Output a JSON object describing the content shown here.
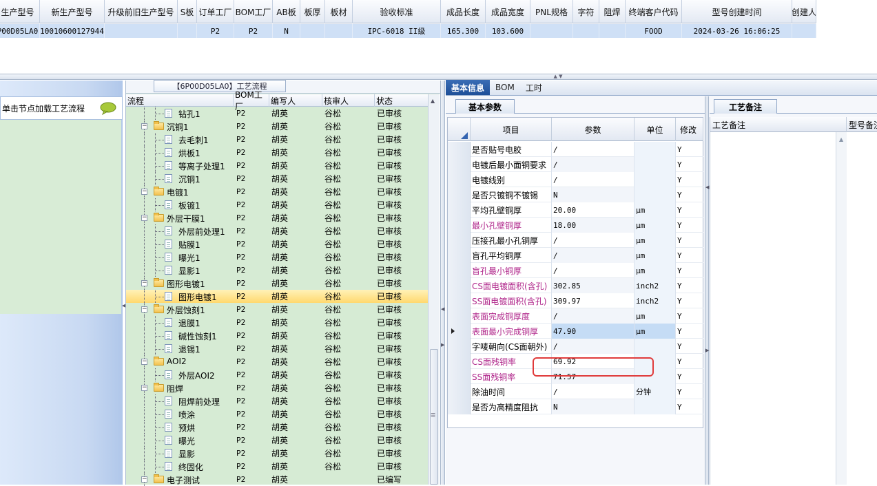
{
  "top_grid": {
    "columns": [
      "生产型号",
      "新生产型号",
      "升级前旧生产型号",
      "S板",
      "订单工厂",
      "BOM工厂",
      "AB板",
      "板厚",
      "板材",
      "验收标准",
      "成品长度",
      "成品宽度",
      "PNL规格",
      "字符",
      "阻焊",
      "终端客户代码",
      "型号创建时间",
      "创建人"
    ],
    "row": [
      "P00D05LA0",
      "10010600127944",
      "",
      "",
      "P2",
      "P2",
      "N",
      "",
      "",
      "IPC-6018 II级",
      "165.300",
      "103.600",
      "",
      "",
      "",
      "FOOD",
      "2024-03-26 16:06:25",
      ""
    ]
  },
  "left_panel": {
    "hint": "单击节点加载工艺流程",
    "icon": "speech-bubble-icon"
  },
  "tree_panel": {
    "title": "【6P00D05LA0】工艺流程",
    "columns": [
      "流程",
      "BOM工厂",
      "编写人",
      "核审人",
      "状态"
    ],
    "rows": [
      {
        "name": "钻孔1",
        "bom": "P2",
        "author": "胡英",
        "reviewer": "谷松",
        "status": "已审核",
        "level": 1,
        "folder": false
      },
      {
        "name": "沉铜1",
        "bom": "P2",
        "author": "胡英",
        "reviewer": "谷松",
        "status": "已审核",
        "level": 0,
        "folder": true
      },
      {
        "name": "去毛刺1",
        "bom": "P2",
        "author": "胡英",
        "reviewer": "谷松",
        "status": "已审核",
        "level": 1,
        "folder": false
      },
      {
        "name": "烘板1",
        "bom": "P2",
        "author": "胡英",
        "reviewer": "谷松",
        "status": "已审核",
        "level": 1,
        "folder": false
      },
      {
        "name": "等离子处理1",
        "bom": "P2",
        "author": "胡英",
        "reviewer": "谷松",
        "status": "已审核",
        "level": 1,
        "folder": false
      },
      {
        "name": "沉铜1",
        "bom": "P2",
        "author": "胡英",
        "reviewer": "谷松",
        "status": "已审核",
        "level": 1,
        "folder": false
      },
      {
        "name": "电镀1",
        "bom": "P2",
        "author": "胡英",
        "reviewer": "谷松",
        "status": "已审核",
        "level": 0,
        "folder": true
      },
      {
        "name": "板镀1",
        "bom": "P2",
        "author": "胡英",
        "reviewer": "谷松",
        "status": "已审核",
        "level": 1,
        "folder": false
      },
      {
        "name": "外层干膜1",
        "bom": "P2",
        "author": "胡英",
        "reviewer": "谷松",
        "status": "已审核",
        "level": 0,
        "folder": true
      },
      {
        "name": "外层前处理1",
        "bom": "P2",
        "author": "胡英",
        "reviewer": "谷松",
        "status": "已审核",
        "level": 1,
        "folder": false
      },
      {
        "name": "贴膜1",
        "bom": "P2",
        "author": "胡英",
        "reviewer": "谷松",
        "status": "已审核",
        "level": 1,
        "folder": false
      },
      {
        "name": "曝光1",
        "bom": "P2",
        "author": "胡英",
        "reviewer": "谷松",
        "status": "已审核",
        "level": 1,
        "folder": false
      },
      {
        "name": "显影1",
        "bom": "P2",
        "author": "胡英",
        "reviewer": "谷松",
        "status": "已审核",
        "level": 1,
        "folder": false
      },
      {
        "name": "图形电镀1",
        "bom": "P2",
        "author": "胡英",
        "reviewer": "谷松",
        "status": "已审核",
        "level": 0,
        "folder": true
      },
      {
        "name": "图形电镀1",
        "bom": "P2",
        "author": "胡英",
        "reviewer": "谷松",
        "status": "已审核",
        "level": 1,
        "folder": false,
        "selected": true
      },
      {
        "name": "外层蚀刻1",
        "bom": "P2",
        "author": "胡英",
        "reviewer": "谷松",
        "status": "已审核",
        "level": 0,
        "folder": true
      },
      {
        "name": "退膜1",
        "bom": "P2",
        "author": "胡英",
        "reviewer": "谷松",
        "status": "已审核",
        "level": 1,
        "folder": false
      },
      {
        "name": "碱性蚀刻1",
        "bom": "P2",
        "author": "胡英",
        "reviewer": "谷松",
        "status": "已审核",
        "level": 1,
        "folder": false
      },
      {
        "name": "退锡1",
        "bom": "P2",
        "author": "胡英",
        "reviewer": "谷松",
        "status": "已审核",
        "level": 1,
        "folder": false
      },
      {
        "name": "AOI2",
        "bom": "P2",
        "author": "胡英",
        "reviewer": "谷松",
        "status": "已审核",
        "level": 0,
        "folder": true
      },
      {
        "name": "外层AOI2",
        "bom": "P2",
        "author": "胡英",
        "reviewer": "谷松",
        "status": "已审核",
        "level": 1,
        "folder": false
      },
      {
        "name": "阻焊",
        "bom": "P2",
        "author": "胡英",
        "reviewer": "谷松",
        "status": "已审核",
        "level": 0,
        "folder": true
      },
      {
        "name": "阻焊前处理",
        "bom": "P2",
        "author": "胡英",
        "reviewer": "谷松",
        "status": "已审核",
        "level": 1,
        "folder": false
      },
      {
        "name": "喷涂",
        "bom": "P2",
        "author": "胡英",
        "reviewer": "谷松",
        "status": "已审核",
        "level": 1,
        "folder": false
      },
      {
        "name": "预烘",
        "bom": "P2",
        "author": "胡英",
        "reviewer": "谷松",
        "status": "已审核",
        "level": 1,
        "folder": false
      },
      {
        "name": "曝光",
        "bom": "P2",
        "author": "胡英",
        "reviewer": "谷松",
        "status": "已审核",
        "level": 1,
        "folder": false
      },
      {
        "name": "显影",
        "bom": "P2",
        "author": "胡英",
        "reviewer": "谷松",
        "status": "已审核",
        "level": 1,
        "folder": false
      },
      {
        "name": "终固化",
        "bom": "P2",
        "author": "胡英",
        "reviewer": "谷松",
        "status": "已审核",
        "level": 1,
        "folder": false
      },
      {
        "name": "电子测试",
        "bom": "P2",
        "author": "胡英",
        "reviewer": "",
        "status": "已编写",
        "level": 0,
        "folder": true
      }
    ]
  },
  "right_tabs": [
    "基本信息",
    "BOM",
    "工时"
  ],
  "basic_panel": {
    "subtab": "基本参数",
    "columns": [
      "项目",
      "参数",
      "单位",
      "修改"
    ],
    "rows": [
      {
        "item": "是否贴号电胶",
        "param": "/",
        "unit": "",
        "mod": "Y",
        "red": false
      },
      {
        "item": "电镀后最小面铜要求",
        "param": "/",
        "unit": "",
        "mod": "Y",
        "red": false
      },
      {
        "item": "电镀线别",
        "param": "/",
        "unit": "",
        "mod": "Y",
        "red": false
      },
      {
        "item": "是否只镀铜不镀锡",
        "param": "N",
        "unit": "",
        "mod": "Y",
        "red": false
      },
      {
        "item": "平均孔壁铜厚",
        "param": "20.00",
        "unit": "μm",
        "mod": "Y",
        "red": false
      },
      {
        "item": "最小孔壁铜厚",
        "param": "18.00",
        "unit": "μm",
        "mod": "Y",
        "red": true
      },
      {
        "item": "压接孔最小孔铜厚",
        "param": "/",
        "unit": "μm",
        "mod": "Y",
        "red": false
      },
      {
        "item": "盲孔平均铜厚",
        "param": "/",
        "unit": "μm",
        "mod": "Y",
        "red": false
      },
      {
        "item": "盲孔最小铜厚",
        "param": "/",
        "unit": "μm",
        "mod": "Y",
        "red": true
      },
      {
        "item": "CS面电镀面积(含孔)",
        "param": "302.85",
        "unit": "inch2",
        "mod": "Y",
        "red": true
      },
      {
        "item": "SS面电镀面积(含孔)",
        "param": "309.97",
        "unit": "inch2",
        "mod": "Y",
        "red": true
      },
      {
        "item": "表面完成铜厚度",
        "param": "/",
        "unit": "μm",
        "mod": "Y",
        "red": true
      },
      {
        "item": "表面最小完成铜厚",
        "param": "47.90",
        "unit": "μm",
        "mod": "Y",
        "red": true,
        "current": true
      },
      {
        "item": "字唛朝向(CS面朝外)",
        "param": "/",
        "unit": "",
        "mod": "Y",
        "red": false
      },
      {
        "item": "CS面残铜率",
        "param": "69.92",
        "unit": "",
        "mod": "Y",
        "red": true
      },
      {
        "item": "SS面残铜率",
        "param": "71.57",
        "unit": "",
        "mod": "Y",
        "red": true
      },
      {
        "item": "除油时间",
        "param": "/",
        "unit": "分钟",
        "mod": "Y",
        "red": false
      },
      {
        "item": "是否为高精度阻抗",
        "param": "N",
        "unit": "",
        "mod": "Y",
        "red": false
      }
    ]
  },
  "note_panel": {
    "subtab": "工艺备注",
    "columns": [
      "工艺备注",
      "型号备注"
    ]
  }
}
